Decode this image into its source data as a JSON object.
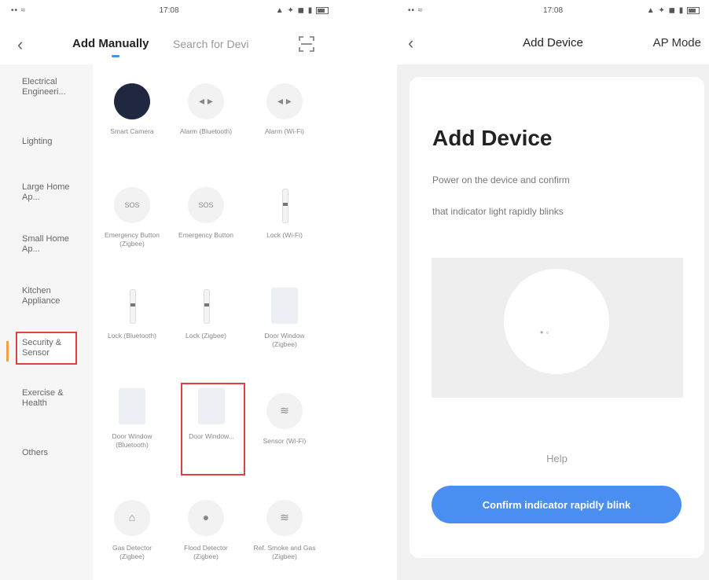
{
  "left_screen": {
    "status": {
      "signal": "••  ≈",
      "time": "17:08",
      "icons": "▲ ✦ ◼ ▮"
    },
    "back_icon": "back-chevron-icon",
    "tabs": {
      "add_manually": "Add Manually",
      "search": "Search for Devi"
    },
    "scan_icon": "scan-icon",
    "categories": [
      "Electrical Engineeri...",
      "Lighting",
      "Large Home Ap...",
      "Small Home Ap...",
      "Kitchen Appliance",
      "Security & Sensor",
      "Exercise & Health",
      "Others"
    ],
    "devices": [
      "Smart Camera",
      "Alarm (Bluetooth)",
      "Alarm (Wi-Fi)",
      "Emergency Button (Zigbee)",
      "Emergency Button",
      "Lock (Wi-Fi)",
      "Lock (Bluetooth)",
      "Lock (Zigbee)",
      "Door Window (Zigbee)",
      "Door Window (Bluetooth)",
      "Door Window...",
      "Sensor (Wi-Fi)",
      "Gas Detector (Zigbee)",
      "Flood Detector (Zigbee)",
      "Ref. Smoke and Gas (Zigbee)"
    ],
    "sos_text": "SOS",
    "accent": "#4a8ef2",
    "highlight_color": "#e0413d"
  },
  "right_screen": {
    "status": {
      "signal": "••  ≈",
      "time": "17:08",
      "icons": "▲ ✦ ◼ ▮"
    },
    "back_icon": "back-chevron-icon",
    "header_title": "Add Device",
    "ap_mode": "AP Mode",
    "card_title": "Add Device",
    "instruction_1": "Power on the device and confirm",
    "instruction_2": "that indicator light rapidly blinks",
    "help": "Help",
    "confirm_button": "Confirm indicator rapidly blink",
    "button_color": "#4a8ef2"
  }
}
